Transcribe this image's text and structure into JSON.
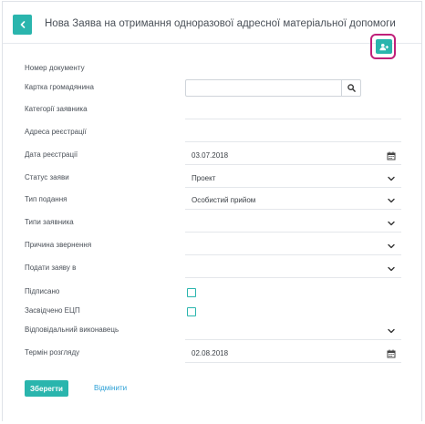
{
  "header": {
    "title": "Нова Заява на отримання одноразової адресної матеріальної допомоги"
  },
  "form": {
    "document_number": {
      "label": "Номер документу",
      "value": ""
    },
    "citizen_card": {
      "label": "Картка громадянина",
      "value": ""
    },
    "applicant_categories": {
      "label": "Категорії заявника",
      "value": ""
    },
    "registration_address": {
      "label": "Адреса реєстрації",
      "value": ""
    },
    "registration_date": {
      "label": "Дата реєстрації",
      "value": "03.07.2018"
    },
    "status": {
      "label": "Статус заяви",
      "value": "Проект"
    },
    "submission_type": {
      "label": "Тип подання",
      "value": "Особистий прийом"
    },
    "applicant_types": {
      "label": "Типи заявника",
      "value": ""
    },
    "appeal_reason": {
      "label": "Причина звернення",
      "value": ""
    },
    "submit_to": {
      "label": "Подати заяву в",
      "value": ""
    },
    "signed": {
      "label": "Підписано",
      "checked": false
    },
    "eds_certified": {
      "label": "Засвідчено ЕЦП",
      "checked": false
    },
    "executor": {
      "label": "Відповідальний виконавець",
      "value": ""
    },
    "review_deadline": {
      "label": "Термін розгляду",
      "value": "02.08.2018"
    }
  },
  "actions": {
    "save_label": "Зберегти",
    "cancel_label": "Відмінити"
  },
  "colors": {
    "accent": "#2ab5ad",
    "highlight": "#c0207a",
    "link": "#2a9fd6"
  }
}
